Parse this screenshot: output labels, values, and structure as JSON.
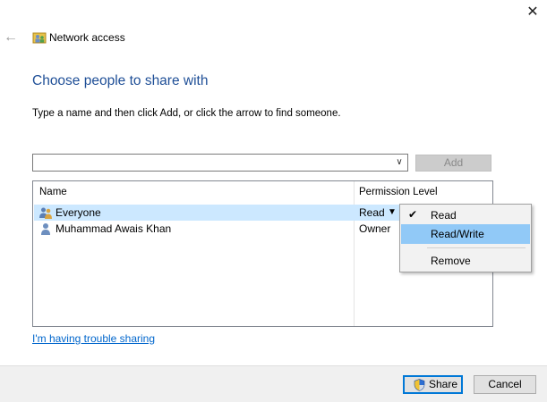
{
  "window": {
    "title": "Network access",
    "close_glyph": "✕",
    "back_glyph": "←"
  },
  "main": {
    "heading": "Choose people to share with",
    "instruction": "Type a name and then click Add, or click the arrow to find someone.",
    "name_input": {
      "value": "",
      "placeholder": ""
    },
    "add_button": "Add"
  },
  "list": {
    "columns": [
      "Name",
      "Permission Level"
    ],
    "rows": [
      {
        "name": "Everyone",
        "permission": "Read",
        "icon": "users-icon",
        "selected": true
      },
      {
        "name": "Muhammad Awais Khan",
        "permission": "Owner",
        "icon": "user-icon",
        "selected": false
      }
    ]
  },
  "permission_menu": {
    "items": [
      {
        "label": "Read",
        "checked": true,
        "highlighted": false
      },
      {
        "label": "Read/Write",
        "checked": false,
        "highlighted": true
      },
      {
        "label": "Remove",
        "checked": false,
        "highlighted": false
      }
    ]
  },
  "trouble_link": "I'm having trouble sharing",
  "footer": {
    "share_button": "Share",
    "cancel_button": "Cancel"
  },
  "colors": {
    "heading": "#1f4f97",
    "selection": "#cce8ff",
    "menu_highlight": "#91c9f7",
    "link": "#0066cc",
    "default_button_border": "#0078d7"
  }
}
